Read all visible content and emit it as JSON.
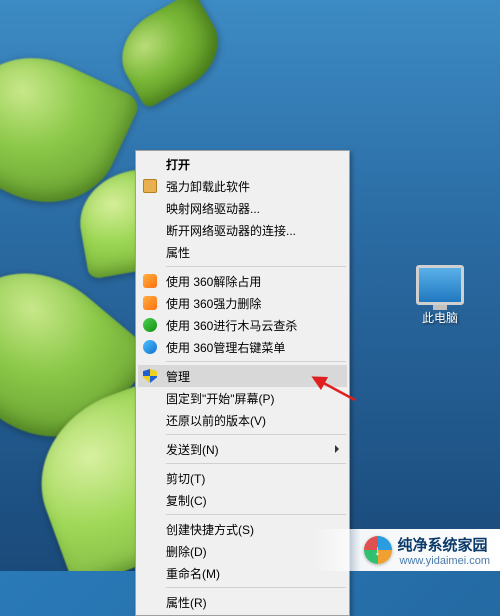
{
  "desktop": {
    "icon_label": "此电脑"
  },
  "menu": {
    "open": "打开",
    "uninstall": "强力卸载此软件",
    "map_drive": "映射网络驱动器...",
    "disconnect_drive": "断开网络驱动器的连接...",
    "properties_top": "属性",
    "unlock_360": "使用 360解除占用",
    "force_delete_360": "使用 360强力删除",
    "trojan_360": "使用 360进行木马云查杀",
    "manage_menu_360": "使用 360管理右键菜单",
    "manage": "管理",
    "pin_start": "固定到\"开始\"屏幕(P)",
    "restore_versions": "还原以前的版本(V)",
    "send_to": "发送到(N)",
    "cut": "剪切(T)",
    "copy": "复制(C)",
    "create_shortcut": "创建快捷方式(S)",
    "delete": "删除(D)",
    "rename": "重命名(M)",
    "properties_bottom": "属性(R)"
  },
  "watermark": {
    "brand": "纯净系统家园",
    "url": "www.yidaimei.com"
  }
}
